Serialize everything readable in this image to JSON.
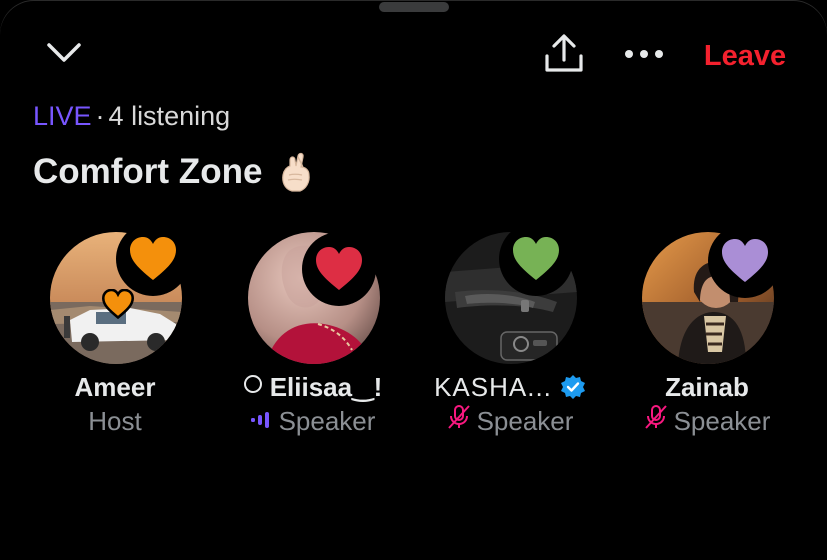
{
  "header": {
    "leave_label": "Leave",
    "icons": [
      "chevron-down-icon",
      "share-icon",
      "more-icon"
    ]
  },
  "status": {
    "live_label": "LIVE",
    "separator": "·",
    "listening": "4 listening"
  },
  "space": {
    "title": "Comfort Zone",
    "title_emoji": "crossed-fingers-emoji"
  },
  "participants": [
    {
      "name": "Ameer",
      "role": "Host",
      "reaction": "orange-heart",
      "reaction_color": "#f4900c"
    },
    {
      "name": "Eliisaa‿!",
      "role": "Speaker",
      "reaction": "red-heart",
      "reaction_color": "#dd2e44",
      "name_prefix_icon": "ring-icon",
      "role_icon": "speaking-icon"
    },
    {
      "name": "KASHA...",
      "role": "Speaker",
      "reaction": "green-heart",
      "reaction_color": "#77b255",
      "verified": true,
      "role_icon": "mic-muted-icon"
    },
    {
      "name": "Zainab",
      "role": "Speaker",
      "reaction": "purple-heart",
      "reaction_color": "#aa8ed6",
      "role_icon": "mic-muted-icon"
    }
  ],
  "colors": {
    "live": "#7856ff",
    "leave": "#f4212e",
    "muted": "#f91880",
    "speaking": "#7856ff",
    "secondary_text": "#8b8f94",
    "verified": "#1d9bf0"
  }
}
